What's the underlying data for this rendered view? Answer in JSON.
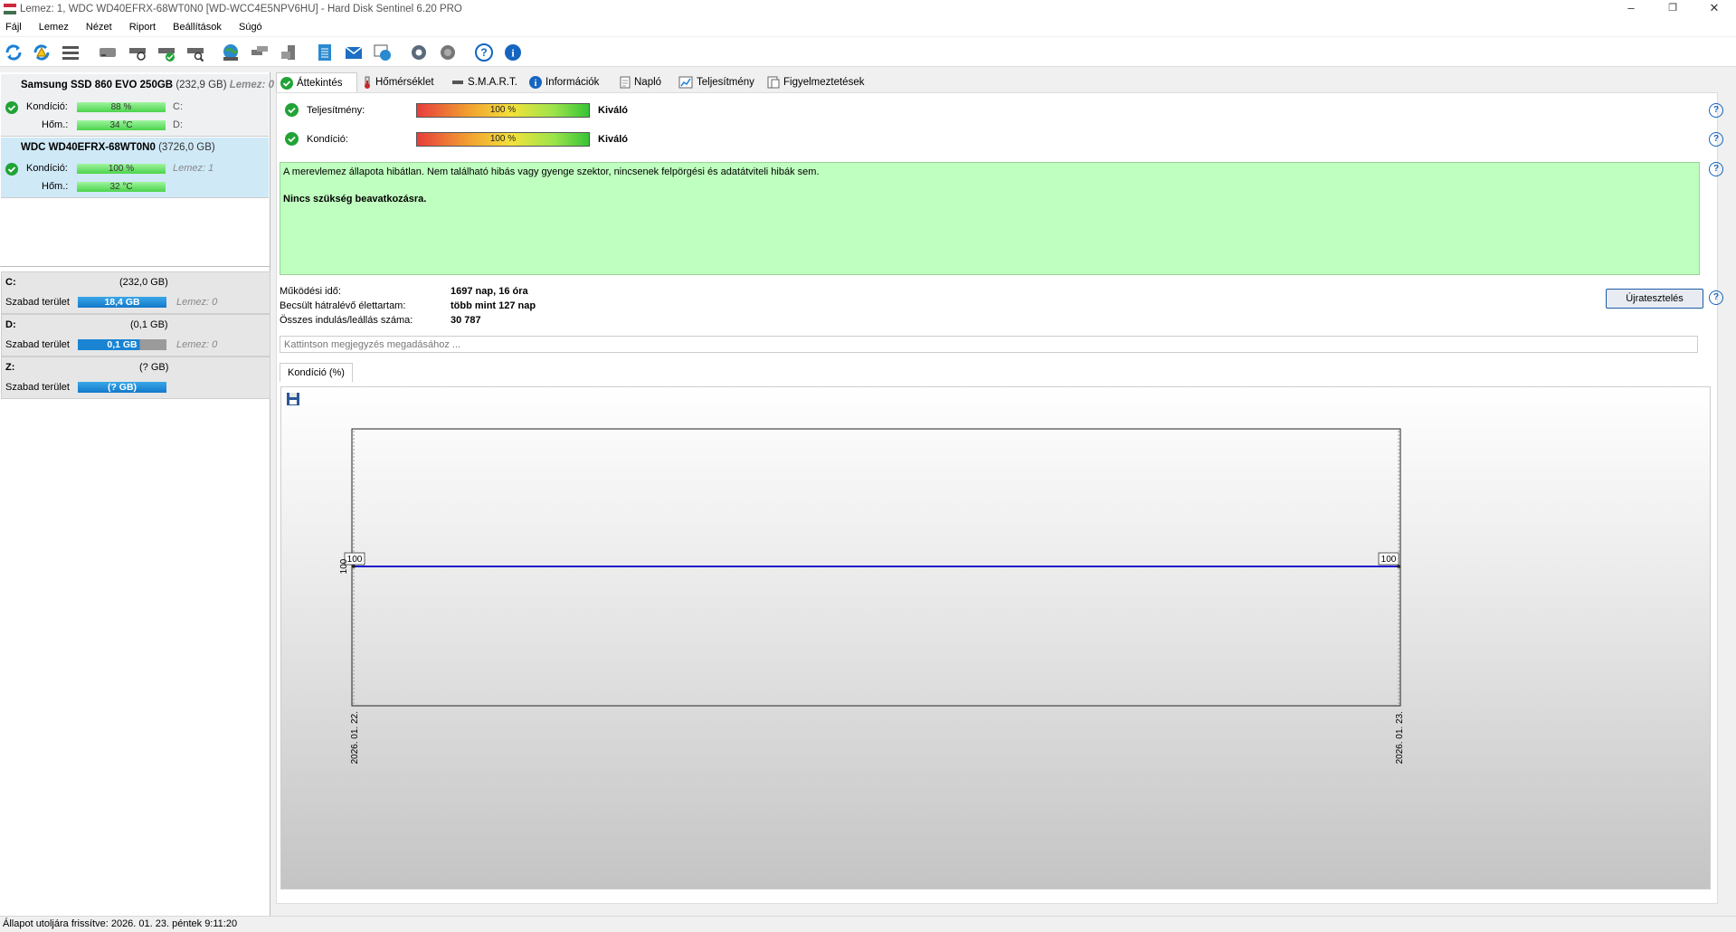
{
  "window": {
    "title": "Lemez: 1, WDC WD40EFRX-68WT0N0 [WD-WCC4E5NPV6HU]  -  Hard Disk Sentinel 6.20 PRO",
    "controls": [
      "–",
      "❐",
      "✕"
    ]
  },
  "menu": [
    "Fájl",
    "Lemez",
    "Nézet",
    "Riport",
    "Beállítások",
    "Súgó"
  ],
  "toolbar": {
    "icons": [
      "refresh-icon",
      "refresh-warning-icon",
      "disk-list-icon",
      "disk-icon",
      "disk-test-icon",
      "disk-ok-icon",
      "disk-search-icon",
      "globe-icon",
      "network-icon",
      "server-icon",
      "report-icon",
      "email-icon",
      "web-report-icon",
      "settings-icon",
      "sound-icon",
      "help-icon",
      "info-icon"
    ]
  },
  "disks": [
    {
      "name": "Samsung SSD 860 EVO 250GB",
      "size": "(232,9 GB)",
      "disk_no": "Lemez: 0",
      "health_label": "Kondíció:",
      "health": "88 %",
      "health_pct": 88,
      "temp_label": "Hőm.:",
      "temp": "34 °C",
      "drives": [
        "C:",
        "D:"
      ]
    },
    {
      "name": "WDC WD40EFRX-68WT0N0",
      "size": "(3726,0 GB)",
      "disk_no": "Lemez: 1",
      "health_label": "Kondíció:",
      "health": "100 %",
      "health_pct": 100,
      "temp_label": "Hőm.:",
      "temp": "32 °C"
    }
  ],
  "volumes": [
    {
      "letter": "C:",
      "size": "(232,0 GB)",
      "free_label": "Szabad terület",
      "free": "18,4 GB",
      "free_fraction": 1.0,
      "bar_color": "#1a84d3",
      "disk": "Lemez: 0"
    },
    {
      "letter": "D:",
      "size": "(0,1 GB)",
      "free_label": "Szabad terület",
      "free": "0,1 GB",
      "free_fraction": 1.0,
      "bar_color": "#9a9a9a",
      "disk": "Lemez: 0"
    },
    {
      "letter": "Z:",
      "size": "(? GB)",
      "free_label": "Szabad terület",
      "free": "(? GB)",
      "free_fraction": 1.0,
      "bar_color": "#1a84d3",
      "disk": ""
    }
  ],
  "tabs": [
    {
      "label": "Áttekintés",
      "icon": "check-icon"
    },
    {
      "label": "Hőmérséklet",
      "icon": "thermometer-icon"
    },
    {
      "label": "S.M.A.R.T.",
      "icon": "smart-icon"
    },
    {
      "label": "Információk",
      "icon": "info-icon"
    },
    {
      "label": "Napló",
      "icon": "log-icon"
    },
    {
      "label": "Teljesítmény",
      "icon": "performance-icon"
    },
    {
      "label": "Figyelmeztetések",
      "icon": "alerts-icon"
    }
  ],
  "overview": {
    "performance_label": "Teljesítmény:",
    "performance_value": "100 %",
    "performance_rating": "Kiváló",
    "health_label": "Kondíció:",
    "health_value": "100 %",
    "health_rating": "Kiváló",
    "status_text": "A merevlemez állapota hibátlan. Nem található hibás vagy gyenge szektor, nincsenek felpörgési és adatátviteli hibák sem.",
    "status_action": "Nincs szükség beavatkozásra.",
    "uptime_label": "Működési idő:",
    "uptime": "1697 nap, 16 óra",
    "lifetime_label": "Becsült hátralévő élettartam:",
    "lifetime": "több mint 127 nap",
    "startstop_label": "Összes indulás/leállás száma:",
    "startstop": "30 787",
    "retest_button": "Újratesztelés",
    "note_placeholder": "Kattintson megjegyzés megadásához ..."
  },
  "chart_tab_label": "Kondíció  (%)",
  "chart_data": {
    "type": "line",
    "x": [
      "2026. 01. 22.",
      "2026. 01. 23."
    ],
    "series": [
      {
        "values": [
          100,
          100
        ],
        "color": "#1a1acc"
      }
    ],
    "ytick_labels": [
      "100"
    ],
    "data_labels": [
      "100",
      "100"
    ]
  },
  "statusbar": {
    "text": "Állapot utoljára frissítve: 2026. 01. 23. péntek 9:11:20"
  }
}
